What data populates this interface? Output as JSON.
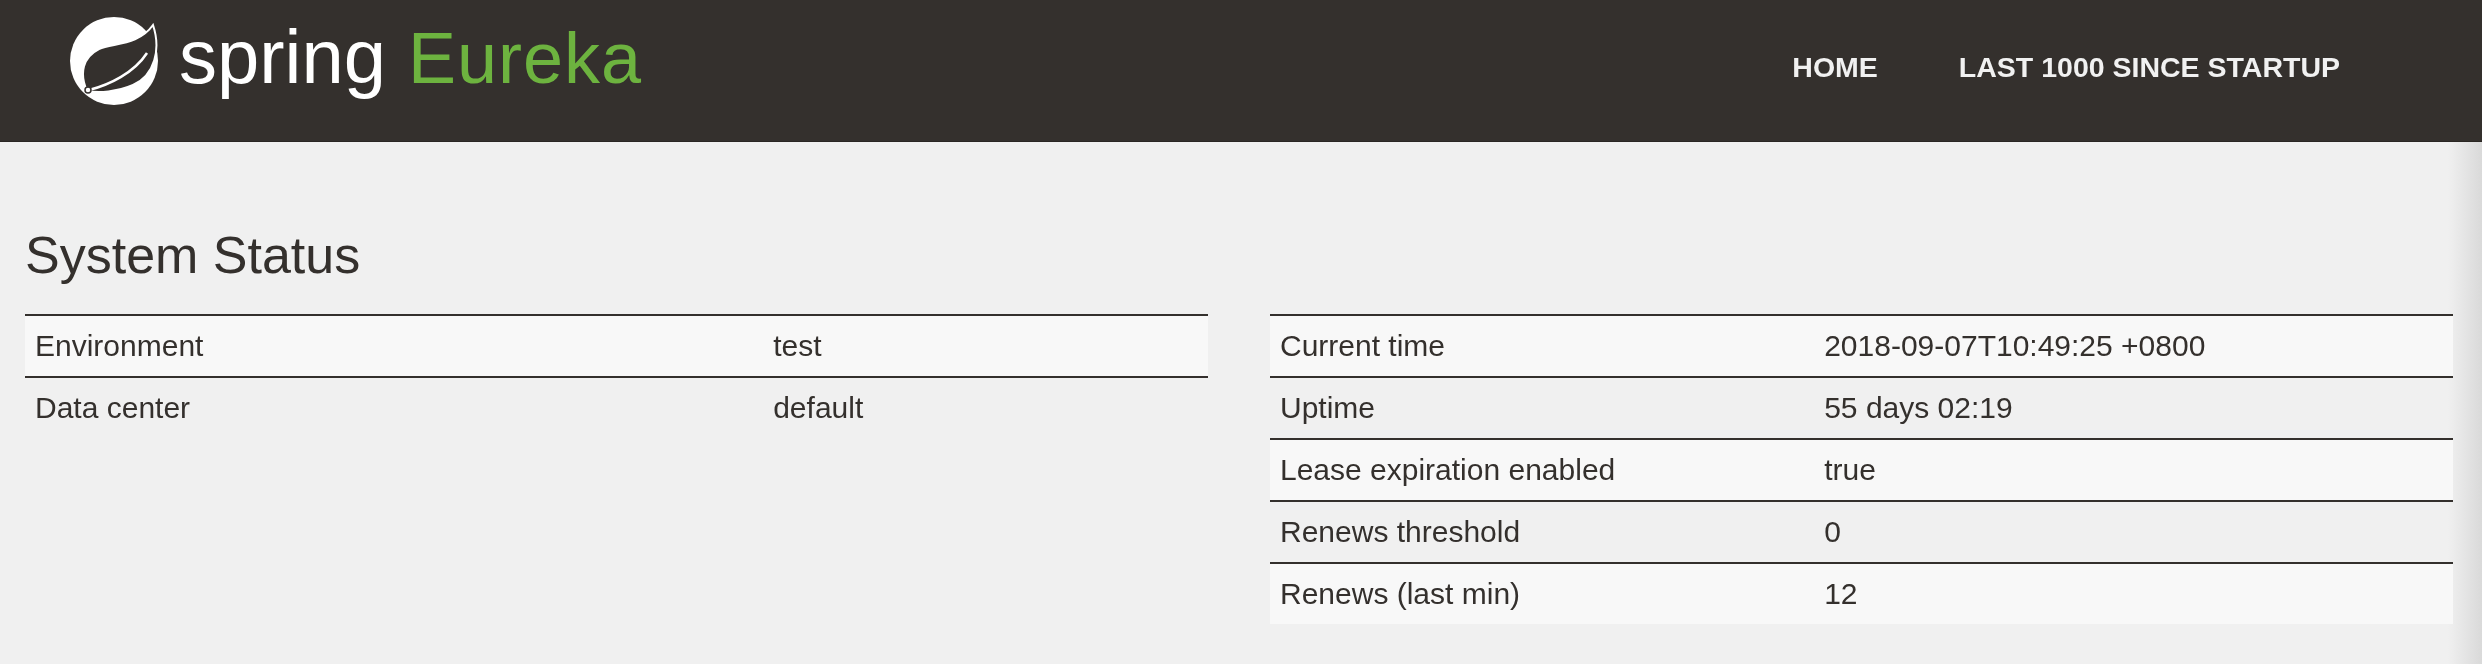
{
  "header": {
    "logo": {
      "brand": "spring",
      "product": "Eureka"
    },
    "nav": [
      {
        "label": "HOME"
      },
      {
        "label": "LAST 1000 SINCE STARTUP"
      }
    ]
  },
  "system_status": {
    "title": "System Status",
    "tables": [
      {
        "rows": [
          {
            "label": "Environment",
            "value": "test"
          },
          {
            "label": "Data center",
            "value": "default"
          }
        ]
      },
      {
        "rows": [
          {
            "label": "Current time",
            "value": "2018-09-07T10:49:25 +0800"
          },
          {
            "label": "Uptime",
            "value": "55 days 02:19"
          },
          {
            "label": "Lease expiration enabled",
            "value": "true"
          },
          {
            "label": "Renews threshold",
            "value": "0"
          },
          {
            "label": "Renews (last min)",
            "value": "12"
          }
        ]
      }
    ]
  }
}
